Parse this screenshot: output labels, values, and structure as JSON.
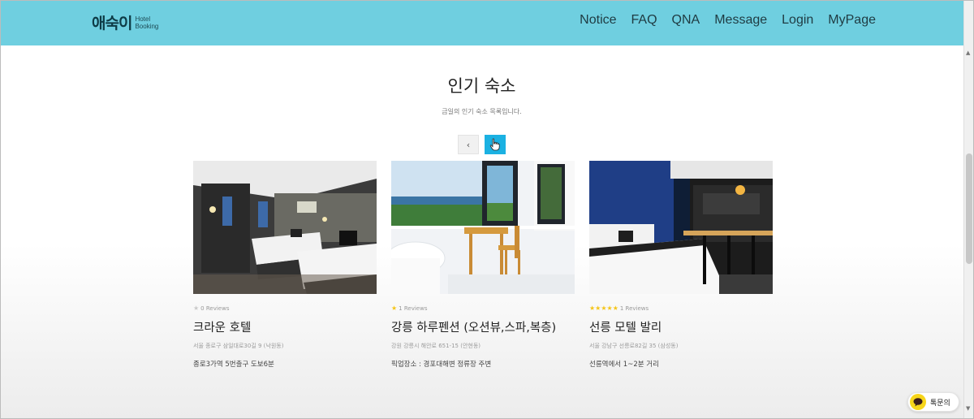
{
  "header": {
    "logo_main": "애숙이",
    "logo_sub": "Hotel Booking",
    "nav": [
      "Notice",
      "FAQ",
      "QNA",
      "Message",
      "Login",
      "MyPage"
    ]
  },
  "section": {
    "title": "인기 숙소",
    "subtitle": "금일의 인기 숙소 목록입니다."
  },
  "pager": {
    "prev": "‹"
  },
  "hotels": [
    {
      "stars": 1,
      "star_filled": false,
      "reviews": "0 Reviews",
      "name": "크라운 호텔",
      "address": "서울 종로구 삼일대로30길 9 (낙원동)",
      "desc": "종로3가역 5번출구 도보6분"
    },
    {
      "stars": 1,
      "star_filled": true,
      "reviews": "1 Reviews",
      "name": "강릉 하루펜션 (오션뷰,스파,복층)",
      "address": "강원 강릉시 해안로 651-15 (안현동)",
      "desc": "픽업장소 : 경포대해변 정류장 주변"
    },
    {
      "stars": 5,
      "star_filled": true,
      "reviews": "1 Reviews",
      "name": "선릉 모텔 발리",
      "address": "서울 강남구 선릉로82길 35 (삼성동)",
      "desc": "선릉역에서 1~2분 거리"
    }
  ],
  "chat": {
    "label": "톡문의"
  },
  "colors": {
    "header": "#6fcfe0",
    "accent": "#1bb1e2",
    "star": "#f5c518"
  }
}
